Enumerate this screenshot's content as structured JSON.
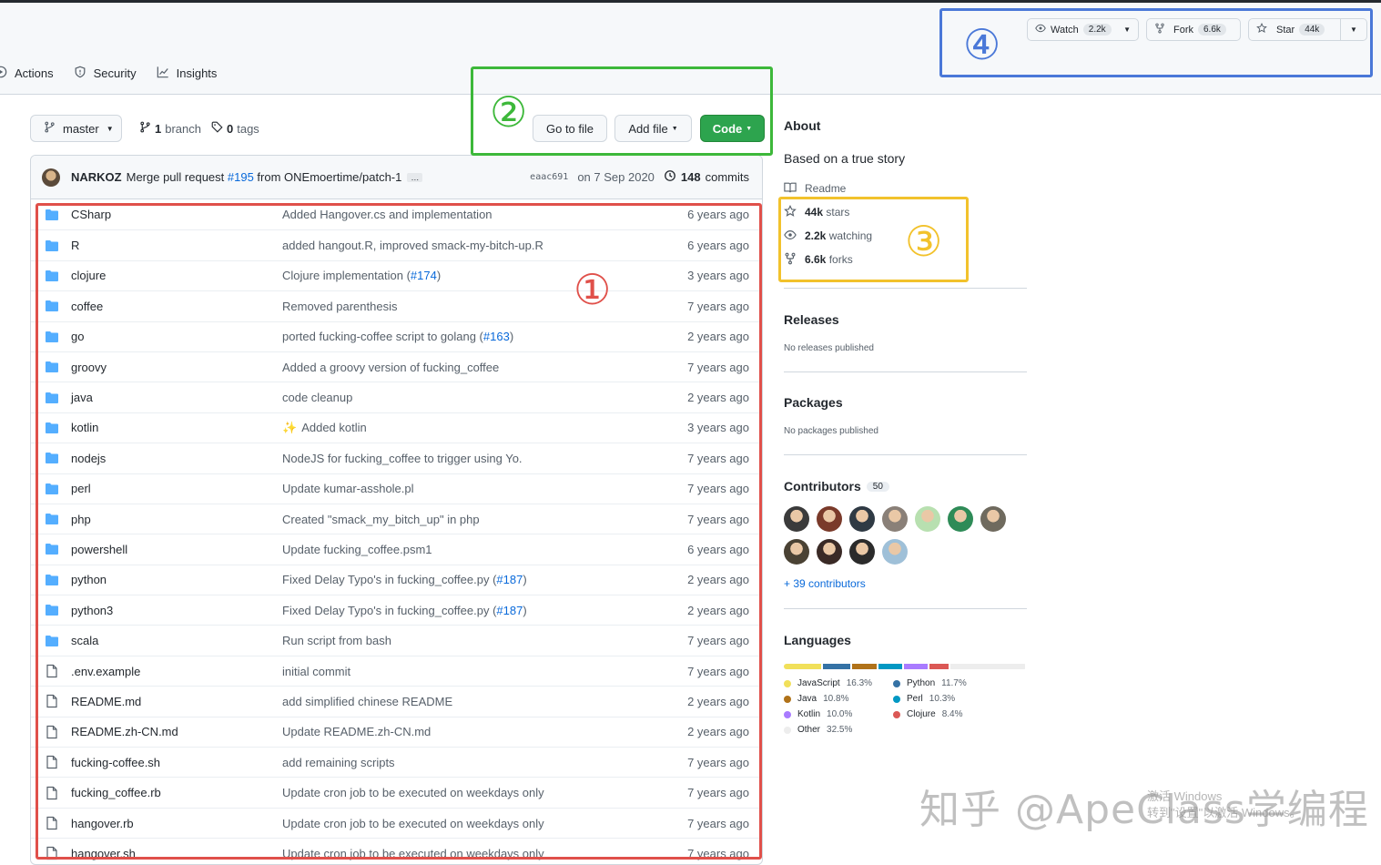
{
  "nav": {
    "items": [
      {
        "label": "Actions",
        "icon": "play-icon"
      },
      {
        "label": "Security",
        "icon": "shield-icon"
      },
      {
        "label": "Insights",
        "icon": "graph-icon"
      }
    ]
  },
  "repo_actions": {
    "watch_label": "Watch",
    "watch_count": "2.2k",
    "fork_label": "Fork",
    "fork_count": "6.6k",
    "star_label": "Star",
    "star_count": "44k"
  },
  "toolbar": {
    "branch": "master",
    "branches_count": "1",
    "branches_label": "branch",
    "tags_count": "0",
    "tags_label": "tags",
    "go_to_file": "Go to file",
    "add_file": "Add file",
    "code": "Code"
  },
  "commit": {
    "author": "NARKOZ",
    "message_prefix": "Merge pull request ",
    "pr": "#195",
    "message_suffix": " from ONEmoertime/patch-1",
    "ellipsis": "…",
    "sha": "eaac691",
    "date": "on 7 Sep 2020",
    "commits_count": "148",
    "commits_label": "commits"
  },
  "files": [
    {
      "type": "dir",
      "name": "CSharp",
      "msg": "Added Hangover.cs and implementation",
      "pr": "",
      "age": "6 years ago"
    },
    {
      "type": "dir",
      "name": "R",
      "msg": "added hangout.R, improved smack-my-bitch-up.R",
      "pr": "",
      "age": "6 years ago"
    },
    {
      "type": "dir",
      "name": "clojure",
      "msg": "Clojure implementation (",
      "pr": "#174",
      "msg_end": ")",
      "age": "3 years ago"
    },
    {
      "type": "dir",
      "name": "coffee",
      "msg": "Removed parenthesis",
      "pr": "",
      "age": "7 years ago"
    },
    {
      "type": "dir",
      "name": "go",
      "msg": "ported fucking-coffee script to golang (",
      "pr": "#163",
      "msg_end": ")",
      "age": "2 years ago"
    },
    {
      "type": "dir",
      "name": "groovy",
      "msg": "Added a groovy version of fucking_coffee",
      "pr": "",
      "age": "7 years ago"
    },
    {
      "type": "dir",
      "name": "java",
      "msg": "code cleanup",
      "pr": "",
      "age": "2 years ago"
    },
    {
      "type": "dir",
      "name": "kotlin",
      "msg": "Added kotlin",
      "emoji": "✨",
      "pr": "",
      "age": "3 years ago"
    },
    {
      "type": "dir",
      "name": "nodejs",
      "msg": "NodeJS for fucking_coffee to trigger using Yo.",
      "pr": "",
      "age": "7 years ago"
    },
    {
      "type": "dir",
      "name": "perl",
      "msg": "Update kumar-asshole.pl",
      "pr": "",
      "age": "7 years ago"
    },
    {
      "type": "dir",
      "name": "php",
      "msg": "Created \"smack_my_bitch_up\" in php",
      "pr": "",
      "age": "7 years ago"
    },
    {
      "type": "dir",
      "name": "powershell",
      "msg": "Update fucking_coffee.psm1",
      "pr": "",
      "age": "6 years ago"
    },
    {
      "type": "dir",
      "name": "python",
      "msg": "Fixed Delay Typo's in fucking_coffee.py (",
      "pr": "#187",
      "msg_end": ")",
      "age": "2 years ago"
    },
    {
      "type": "dir",
      "name": "python3",
      "msg": "Fixed Delay Typo's in fucking_coffee.py (",
      "pr": "#187",
      "msg_end": ")",
      "age": "2 years ago"
    },
    {
      "type": "dir",
      "name": "scala",
      "msg": "Run script from bash",
      "pr": "",
      "age": "7 years ago"
    },
    {
      "type": "file",
      "name": ".env.example",
      "msg": "initial commit",
      "pr": "",
      "age": "7 years ago"
    },
    {
      "type": "file",
      "name": "README.md",
      "msg": "add simplified chinese README",
      "pr": "",
      "age": "2 years ago"
    },
    {
      "type": "file",
      "name": "README.zh-CN.md",
      "msg": "Update README.zh-CN.md",
      "pr": "",
      "age": "2 years ago"
    },
    {
      "type": "file",
      "name": "fucking-coffee.sh",
      "msg": "add remaining scripts",
      "pr": "",
      "age": "7 years ago"
    },
    {
      "type": "file",
      "name": "fucking_coffee.rb",
      "msg": "Update cron job to be executed on weekdays only",
      "pr": "",
      "age": "7 years ago"
    },
    {
      "type": "file",
      "name": "hangover.rb",
      "msg": "Update cron job to be executed on weekdays only",
      "pr": "",
      "age": "7 years ago"
    },
    {
      "type": "file",
      "name": "hangover.sh",
      "msg": "Update cron job to be executed on weekdays only",
      "pr": "",
      "age": "7 years ago"
    }
  ],
  "about": {
    "heading": "About",
    "description": "Based on a true story",
    "readme": "Readme",
    "stars_count": "44k",
    "stars_label": "stars",
    "watching_count": "2.2k",
    "watching_label": "watching",
    "forks_count": "6.6k",
    "forks_label": "forks"
  },
  "releases": {
    "heading": "Releases",
    "note": "No releases published"
  },
  "packages": {
    "heading": "Packages",
    "note": "No packages published"
  },
  "contributors": {
    "heading": "Contributors",
    "count": "50",
    "more": "+ 39 contributors",
    "avatar_colors": [
      "#3b3b3b",
      "#7a3a2a",
      "#2f3a44",
      "#8a8078",
      "#b8e0b0",
      "#2e8b57",
      "#6f6a5e",
      "#4a4234",
      "#3a2a26",
      "#2b2b2b",
      "#9fc0d8"
    ]
  },
  "languages": {
    "heading": "Languages",
    "items": [
      {
        "name": "JavaScript",
        "pct": "16.3%",
        "value": 16.3,
        "color": "#f1e05a"
      },
      {
        "name": "Python",
        "pct": "11.7%",
        "value": 11.7,
        "color": "#3572A5"
      },
      {
        "name": "Java",
        "pct": "10.8%",
        "value": 10.8,
        "color": "#b07219"
      },
      {
        "name": "Perl",
        "pct": "10.3%",
        "value": 10.3,
        "color": "#0298c3"
      },
      {
        "name": "Kotlin",
        "pct": "10.0%",
        "value": 10.0,
        "color": "#A97BFF"
      },
      {
        "name": "Clojure",
        "pct": "8.4%",
        "value": 8.4,
        "color": "#db5855"
      },
      {
        "name": "Other",
        "pct": "32.5%",
        "value": 32.5,
        "color": "#ededed"
      }
    ]
  },
  "annotations": {
    "n1": "①",
    "n2": "②",
    "n3": "③",
    "n4": "④",
    "colors": {
      "red": "#e0504a",
      "green": "#3db83a",
      "yellow": "#f2c22c",
      "blue": "#4a78d8"
    }
  },
  "watermark": "知乎 @ApeClass学编程",
  "activate_line1": "激活 Windows",
  "activate_line2": "转到\"设置\"以激活 Windows。"
}
